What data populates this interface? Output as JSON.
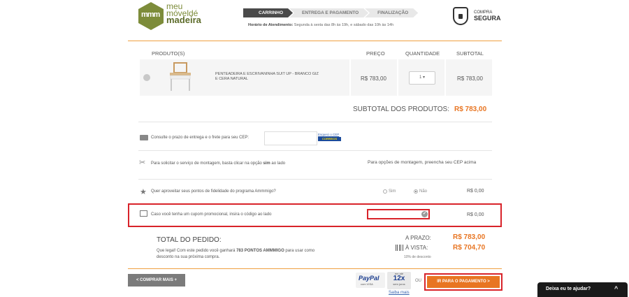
{
  "brand": {
    "logo_mark": "mmm",
    "line1": "meu",
    "line2": "móveldé",
    "line3": "madeira"
  },
  "steps": [
    "CARRINHO",
    "ENTREGA E PAGAMENTO",
    "FINALIZAÇÃO"
  ],
  "hours": {
    "label": "Horário de Atendimento:",
    "text": " Segunda à sexta das 8h às 19h, e sábado das 10h às 14h"
  },
  "secure": {
    "line1": "COMPRA",
    "line2": "SEGURA"
  },
  "table_headers": {
    "product": "PRODUTO(S)",
    "price": "PREÇO",
    "quantity": "QUANTIDADE",
    "subtotal": "SUBTOTAL"
  },
  "product": {
    "name": "PENTEADEIRA E ESCRIVANINHA SUIT UP - BRANCO GIZ E CERA NATURAL",
    "price": "R$ 783,00",
    "quantity": "1",
    "subtotal": "R$ 783,00"
  },
  "subtotal_products": {
    "label": "SUBTOTAL DOS PRODUTOS:",
    "value": "R$ 783,00"
  },
  "shipping": {
    "text": "Consulte o prazo de entrega e o frete para seu CEP:",
    "cep_placeholder": "",
    "forgot_cep": "Esqueci o CEP",
    "correios": "CORREIOS"
  },
  "assembly": {
    "text_before": "Para solicitar o serviço de montagem, basta clicar na opção ",
    "text_bold": "sim",
    "text_after": " ao lado",
    "note": "Para opções de montagem, preencha seu CEP acima"
  },
  "loyalty": {
    "text": "Quer aproveitar seus pontos de fidelidade do programa Ammmigo?",
    "yes": "Sim",
    "no": "Não",
    "selected": "Não",
    "value": "R$ 0,00"
  },
  "coupon": {
    "text": "Caso você tenha um cupom promocional, insira o código ao lado",
    "value": "R$ 0,00",
    "input_value": ""
  },
  "total": {
    "label": "TOTAL DO PEDIDO:",
    "note_before": "Que legal! Com este pedido você ganhará ",
    "note_bold": "783 PONTOS AMMMIGO",
    "note_after": " para usar como desconto na sua próxima compra.",
    "prazo_label": "A PRAZO:",
    "prazo_value": "R$ 783,00",
    "vista_label": "À VISTA:",
    "vista_value": "R$ 704,70",
    "discount": "10% de desconto"
  },
  "footer": {
    "buy_more": "< COMPRAR MAIS +",
    "paypal": "PayPal",
    "paypal_sub": "com VISA",
    "installments_top": "em até",
    "installments": "12x",
    "installments_bottom": "sem juros",
    "learn_more": "Saiba mais",
    "or": "OU",
    "pay": "IR PARA O PAGAMENTO >"
  },
  "help_widget": {
    "label": "Deixa eu te ajudar?",
    "icon": "^"
  },
  "colors": {
    "accent": "#e87522",
    "brand": "#7d8c3a",
    "highlight": "#d8232a"
  }
}
